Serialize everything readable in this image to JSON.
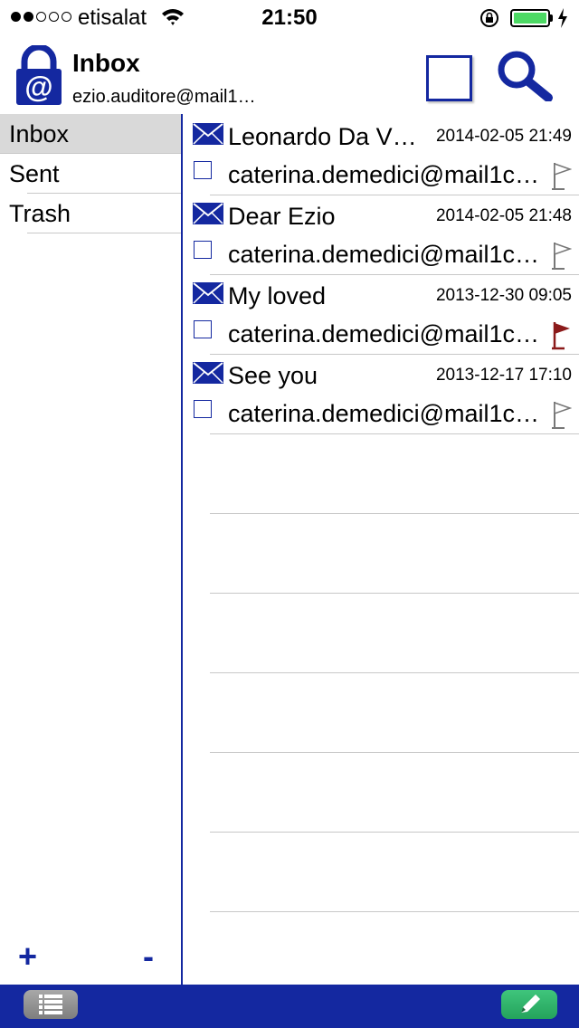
{
  "status_bar": {
    "carrier": "etisalat",
    "time": "21:50",
    "signal_strength": 2,
    "signal_max": 5,
    "battery_level": 1.0
  },
  "header": {
    "title": "Inbox",
    "account": "ezio.auditore@mail1…"
  },
  "sidebar": {
    "folders": [
      {
        "label": "Inbox",
        "active": true
      },
      {
        "label": "Sent",
        "active": false
      },
      {
        "label": "Trash",
        "active": false
      }
    ],
    "add_label": "+",
    "remove_label": "-"
  },
  "messages": [
    {
      "subject": "Leonardo Da V…",
      "date": "2014-02-05 21:49",
      "sender": "caterina.demedici@mail1c…",
      "flagged": false
    },
    {
      "subject": "Dear Ezio",
      "date": "2014-02-05 21:48",
      "sender": "caterina.demedici@mail1c…",
      "flagged": false
    },
    {
      "subject": "My loved",
      "date": "2013-12-30 09:05",
      "sender": "caterina.demedici@mail1c…",
      "flagged": true
    },
    {
      "subject": "See you",
      "date": "2013-12-17 17:10",
      "sender": "caterina.demedici@mail1c…",
      "flagged": false
    }
  ],
  "colors": {
    "accent": "#1428a0",
    "flag_active": "#8b1a1a",
    "flag_inactive": "#ffffff",
    "compose": "#2db46a",
    "battery": "#4cd964"
  },
  "icons": {
    "header": [
      "lock-mail-icon",
      "select-all-checkbox",
      "search-icon"
    ],
    "toolbar": [
      "list-icon",
      "pencil-icon"
    ]
  }
}
